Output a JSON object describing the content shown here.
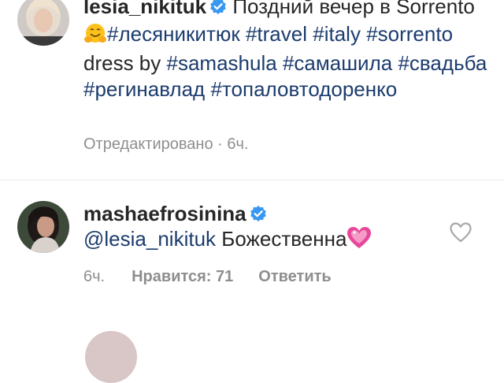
{
  "caption": {
    "username": "lesia_nikituk",
    "verified": true,
    "text_before_emoji": "Поздний вечер в Sorrento",
    "emoji": "hugging-face-emoji",
    "hashtags": [
      "#лесяникитюк",
      "#travel",
      "#italy",
      "#sorrento"
    ],
    "dress_by": "dress by",
    "hashtags_2": [
      "#samashula",
      "#самашила",
      "#свадьба",
      "#регинавлад",
      "#топаловтодоренко"
    ],
    "edited_label": "Отредактировано",
    "separator": "·",
    "time": "6ч."
  },
  "comment": {
    "username": "mashaefrosinina",
    "verified": true,
    "mention": "@lesia_nikituk",
    "text": "Божественна",
    "emoji": "sparkling-heart-emoji",
    "time": "6ч.",
    "likes_label": "Нравится: 71",
    "reply_label": "Ответить"
  },
  "colors": {
    "text": "#262626",
    "secondary": "#8e8e8e",
    "link": "#1c3c6e",
    "verified": "#3897f0",
    "heart_emoji": "#e8479a"
  }
}
